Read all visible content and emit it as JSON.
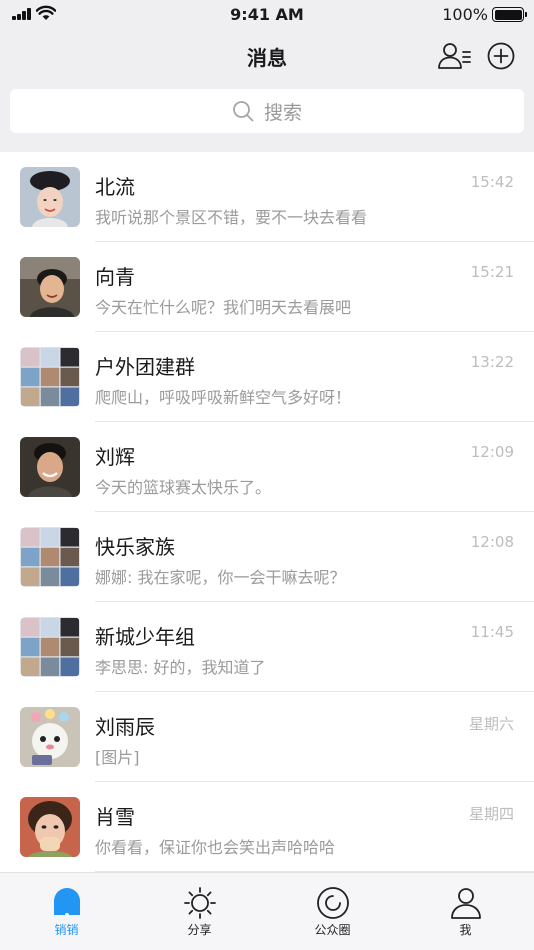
{
  "status_bar": {
    "time": "9:41 AM",
    "battery": "100%"
  },
  "header": {
    "title": "消息"
  },
  "search": {
    "placeholder": "搜索"
  },
  "conversations": [
    {
      "name": "北流",
      "preview": "我听说那个景区不错，要不一块去看看",
      "time": "15:42",
      "avatar": "photo"
    },
    {
      "name": "向青",
      "preview": "今天在忙什么呢？我们明天去看展吧",
      "time": "15:21",
      "avatar": "photo"
    },
    {
      "name": "户外团建群",
      "preview": "爬爬山，呼吸呼吸新鲜空气多好呀！",
      "time": "13:22",
      "avatar": "group"
    },
    {
      "name": "刘辉",
      "preview": "今天的篮球赛太快乐了。",
      "time": "12:09",
      "avatar": "photo"
    },
    {
      "name": "快乐家族",
      "preview": "娜娜: 我在家呢，你一会干嘛去呢？",
      "time": "12:08",
      "avatar": "group"
    },
    {
      "name": "新城少年组",
      "preview": "李思思: 好的，我知道了",
      "time": "11:45",
      "avatar": "group"
    },
    {
      "name": "刘雨辰",
      "preview": "[图片]",
      "time": "星期六",
      "avatar": "photo"
    },
    {
      "name": "肖雪",
      "preview": "你看看，保证你也会笑出声哈哈哈",
      "time": "星期四",
      "avatar": "photo"
    }
  ],
  "tabs": [
    {
      "label": "销销",
      "icon": "chat-bubble-icon",
      "active": true
    },
    {
      "label": "分享",
      "icon": "sun-icon",
      "active": false
    },
    {
      "label": "公众圈",
      "icon": "circle-icon",
      "active": false
    },
    {
      "label": "我",
      "icon": "person-icon",
      "active": false
    }
  ],
  "colors": {
    "accent": "#2196f3",
    "timestamp": "#bdbdbd",
    "preview": "#9b9b9b"
  }
}
